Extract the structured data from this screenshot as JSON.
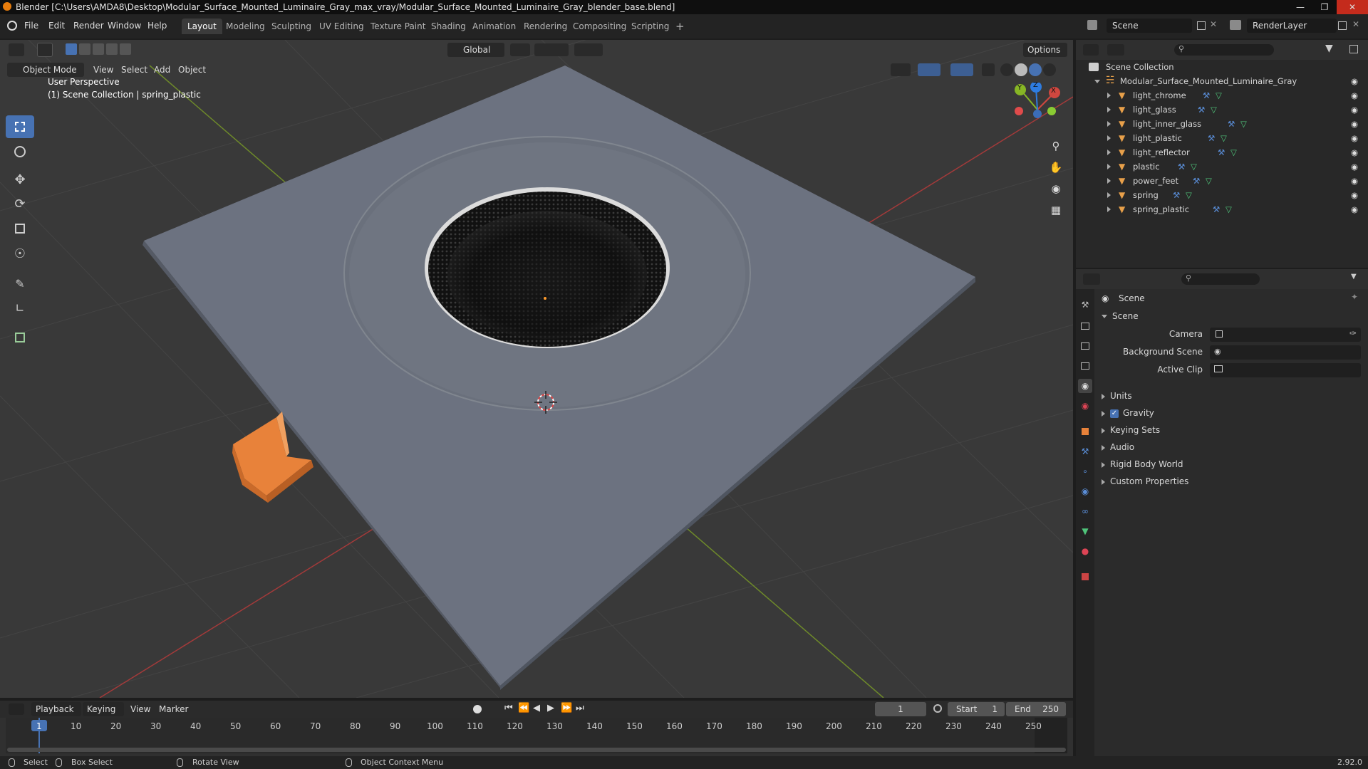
{
  "window": {
    "title": "Blender [C:\\Users\\AMDA8\\Desktop\\Modular_Surface_Mounted_Luminaire_Gray_max_vray/Modular_Surface_Mounted_Luminaire_Gray_blender_base.blend]"
  },
  "menu": {
    "items": [
      "File",
      "Edit",
      "Render",
      "Window",
      "Help"
    ],
    "workspaces": [
      "Layout",
      "Modeling",
      "Sculpting",
      "UV Editing",
      "Texture Paint",
      "Shading",
      "Animation",
      "Rendering",
      "Compositing",
      "Scripting"
    ],
    "active_workspace": "Layout",
    "add_tab": "+",
    "scene_name": "Scene",
    "view_layer": "RenderLayer"
  },
  "viewport": {
    "transform_orientation": "Global",
    "options_label": "Options",
    "mode": "Object Mode",
    "header_menus": [
      "View",
      "Select",
      "Add",
      "Object"
    ],
    "overlay_line1": "User Perspective",
    "overlay_line2": "(1) Scene Collection | spring_plastic",
    "gizmo": {
      "x": "X",
      "y": "Y",
      "z": "Z"
    }
  },
  "timeline": {
    "menus": [
      "Playback",
      "Keying",
      "View",
      "Marker"
    ],
    "current_frame": "1",
    "start_label": "Start",
    "start": "1",
    "end_label": "End",
    "end": "250",
    "ticks": [
      "1",
      "10",
      "20",
      "30",
      "40",
      "50",
      "60",
      "70",
      "80",
      "90",
      "100",
      "110",
      "120",
      "130",
      "140",
      "150",
      "160",
      "170",
      "180",
      "190",
      "200",
      "210",
      "220",
      "230",
      "240",
      "250"
    ]
  },
  "statusbar": {
    "select": "Select",
    "box_select": "Box Select",
    "rotate_view": "Rotate View",
    "context_menu": "Object Context Menu",
    "version": "2.92.0"
  },
  "outliner": {
    "root": "Scene Collection",
    "collection": "Modular_Surface_Mounted_Luminaire_Gray",
    "objects": [
      "light_chrome",
      "light_glass",
      "light_inner_glass",
      "light_plastic",
      "light_reflector",
      "plastic",
      "power_feet",
      "spring",
      "spring_plastic"
    ]
  },
  "properties": {
    "context": "Scene",
    "panel": "Scene",
    "camera_label": "Camera",
    "background_scene_label": "Background Scene",
    "active_clip_label": "Active Clip",
    "sections": [
      "Units",
      "Gravity",
      "Keying Sets",
      "Audio",
      "Rigid Body World",
      "Custom Properties"
    ]
  },
  "colors": {
    "accent": "#4772b3",
    "selected_object": "#e8823a",
    "axis_x": "#d0473f",
    "axis_y": "#87b625",
    "axis_z": "#2e7ce0"
  }
}
